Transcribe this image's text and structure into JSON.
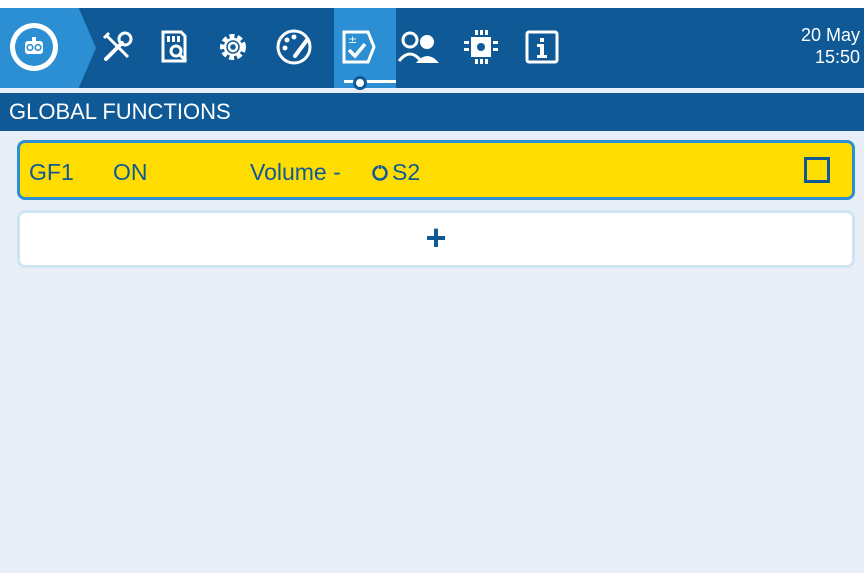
{
  "header": {
    "tabs": [
      {
        "icon": "model-icon"
      },
      {
        "icon": "tools-icon"
      },
      {
        "icon": "sd-card-icon"
      },
      {
        "icon": "gear-icon"
      },
      {
        "icon": "theme-palette-icon"
      },
      {
        "icon": "global-functions-icon",
        "active": true
      },
      {
        "icon": "users-icon"
      },
      {
        "icon": "hardware-chip-icon"
      },
      {
        "icon": "info-icon"
      }
    ],
    "date": "20 May",
    "time": "15:50"
  },
  "section": {
    "title": "GLOBAL FUNCTIONS"
  },
  "functions": [
    {
      "id": "GF1",
      "state": "ON",
      "action": "Volume - ",
      "source_icon": "pot-icon",
      "source": "S2",
      "enabled": false
    }
  ],
  "add_button": {
    "label": "+"
  },
  "colors": {
    "dark_blue": "#0f5a96",
    "active_blue": "#2d8fd3",
    "highlight_yellow": "#ffdd00",
    "background": "#e8eef6"
  }
}
